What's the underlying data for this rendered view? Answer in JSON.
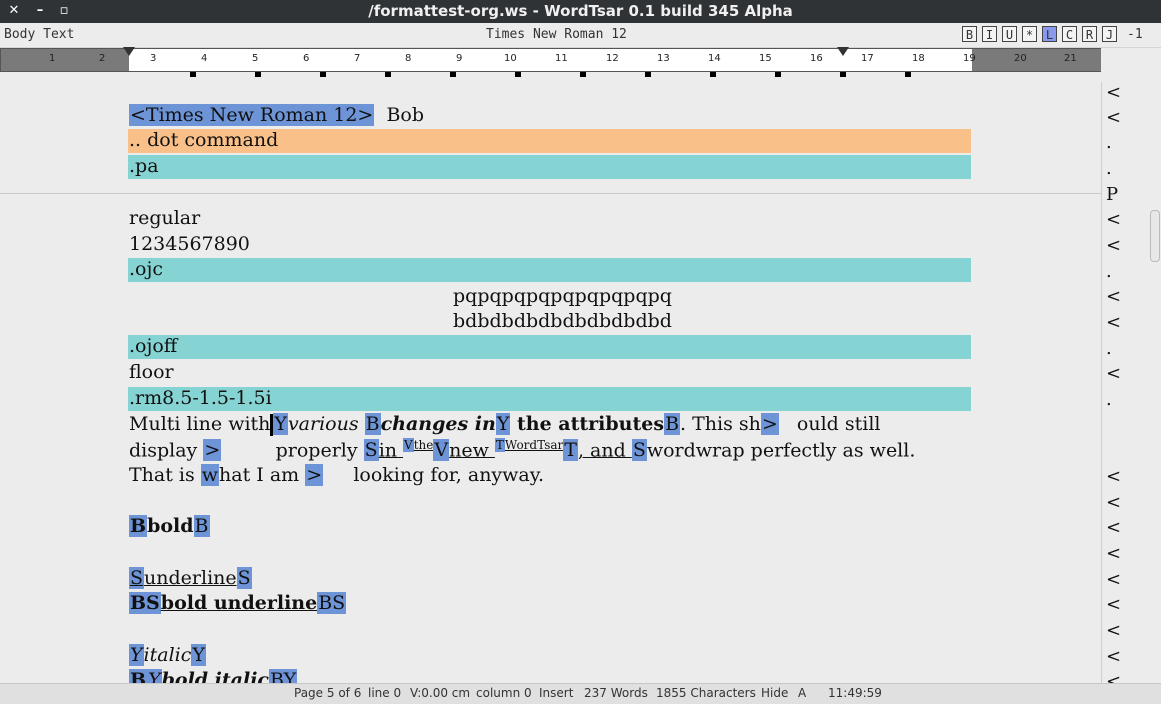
{
  "window": {
    "title": "/formattest-org.ws - WordTsar 0.1 build 345 Alpha"
  },
  "formatbar": {
    "style": "Body Text",
    "font": "Times New Roman 12",
    "buttons": [
      "B",
      "I",
      "U",
      "*",
      "L",
      "C",
      "R",
      "J"
    ],
    "active_button": "L",
    "indent": "-1"
  },
  "ruler": {
    "numbers": [
      "1",
      "2",
      "3",
      "4",
      "5",
      "6",
      "7",
      "8",
      "9",
      "10",
      "11",
      "12",
      "13",
      "14",
      "15",
      "16",
      "17",
      "18",
      "19",
      "20",
      "21"
    ]
  },
  "doc": {
    "top_font_tag": "<Times New Roman 12>",
    "top_bob": "Bob",
    "dot_command": ".. dot command",
    "pa": ".pa",
    "regular": "regular",
    "digits": "1234567890",
    "ojc": ".ojc",
    "pq": "pqpqpqpqpqpqpqpqpq",
    "bd": "bdbdbdbdbdbdbdbdbd",
    "ojoff": ".ojoff",
    "floor": "floor",
    "rm": ".rm8.5-1.5-1.5i",
    "l1_a": "Multi line with",
    "l1_y1": "Y",
    "l1_various": "various ",
    "l1_b1": "B",
    "l1_changes": "changes in",
    "l1_y2": "Y",
    "l1_attr": " the attributes",
    "l1_b2": "B",
    "l1_this": ". This sh",
    "l1_gt": ">",
    "l1_ould": "ould still",
    "l2_display": "display ",
    "l2_gt": ">",
    "l2_properly": "properly ",
    "l2_s1": "S",
    "l2_in": "in ",
    "l2_v1": "V",
    "l2_the": "the",
    "l2_v2": "V",
    "l2_new": "new ",
    "l2_t1": "T",
    "l2_wordtsar": "WordTsar",
    "l2_t2": "T",
    "l2_and": ", and ",
    "l2_s2": "S",
    "l2_rest": "wordwrap perfectly as well.",
    "l3_a": "That is ",
    "l3_w": "w",
    "l3_b": "hat I am ",
    "l3_gt": ">",
    "l3_c": "looking for, anyway.",
    "bold_b": "B",
    "bold_text": "bold",
    "ul_s": "S",
    "ul_text": "underline",
    "bu_bs": "BS",
    "bu_text": "bold underline",
    "it_y": "Y",
    "it_text": "italic",
    "bi_b": "B",
    "bi_y": "Y",
    "bi_text": "bold italic",
    "bi_by": "BY"
  },
  "marks": [
    "<",
    "<",
    ".",
    ".",
    "P",
    "<",
    "<",
    ".",
    "<",
    "<",
    ".",
    "<",
    ".",
    "<",
    "<",
    "<",
    "<",
    "<",
    "<",
    "<",
    "<",
    "<"
  ],
  "status": {
    "page": "Page 5 of 6",
    "line": "line 0",
    "v": "V:0.00 cm",
    "column": "column 0",
    "mode": "Insert",
    "words": "237 Words",
    "chars": "1855 Characters",
    "hide": "Hide",
    "a": "A",
    "time": "11:49:59"
  }
}
